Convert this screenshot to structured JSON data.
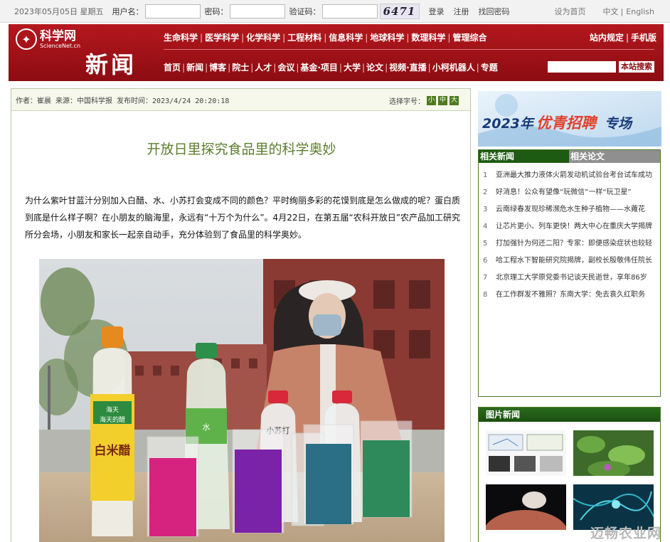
{
  "topbar": {
    "date": "2023年05月05日 星期五",
    "username_label": "用户名：",
    "password_label": "密码：",
    "captcha_label": "验证码：",
    "captcha_text": "6471",
    "login": "登录",
    "register": "注册",
    "forgot": "找回密码",
    "set_home": "设为首页",
    "lang_cn": "中文",
    "lang_sep": "|",
    "lang_en": "English"
  },
  "header": {
    "logo_cn": "科学网",
    "logo_en": "ScienceNet.cn",
    "section": "新闻",
    "nav1": [
      "生命科学",
      "医学科学",
      "化学科学",
      "工程材料",
      "信息科学",
      "地球科学",
      "数理科学",
      "管理综合"
    ],
    "nav_right": [
      "站内规定",
      "手机版"
    ],
    "nav2": [
      "首页",
      "新闻",
      "博客",
      "院士",
      "人才",
      "会议",
      "基金·项目",
      "大学",
      "论文",
      "视频·直播",
      "小柯机器人",
      "专题"
    ],
    "search_button": "本站搜索"
  },
  "article": {
    "meta": "作者：崔晨 来源：中国科学报 发布时间：2023/4/24 20:20:18",
    "font_select_label": "选择字号：",
    "font_sizes": [
      "小",
      "中",
      "大"
    ],
    "title": "开放日里探究食品里的科学奥妙",
    "body": "为什么紫叶甘蓝汁分别加入白醋、水、小苏打会变成不同的颜色？平时绚丽多彩的花馍到底是怎么做成的呢？蛋白质到底是什么样子啊？在小朋友的脑海里，永远有“十万个为什么”。4月22日，在第五届“农科开放日”农产品加工研究所分会场，小朋友和家长一起亲自动手，充分体验到了食品里的科学奥妙。",
    "photo": {
      "bottle1_brand": "海天",
      "bottle1_brand2": "海天的醋",
      "bottle1_label": "白米醋",
      "bottle2_label": "水",
      "bottle3_label": "小苏打",
      "colors": {
        "magenta": "#d6237f",
        "purple": "#7a22a8",
        "clear": "#e9eef0",
        "teal": "#2a6f86",
        "green": "#2e8a5a"
      }
    }
  },
  "sidebar": {
    "banner_year": "2023年",
    "banner_highlight": "优青招聘",
    "banner_tail": "专场",
    "tab_news": "相关新闻",
    "tab_papers": "相关论文",
    "related": [
      {
        "num": "1",
        "text": "亚洲最大推力液体火箭发动机试验台考台试车成功"
      },
      {
        "num": "2",
        "text": "好消息！公众有望像“玩微信”一样“玩卫星”"
      },
      {
        "num": "3",
        "text": "云南绿春发现珍稀濒危水生种子植物——水蕹花"
      },
      {
        "num": "4",
        "text": "让芯片更小、列车更快！两大中心在重庆大学揭牌"
      },
      {
        "num": "5",
        "text": "打加强针为何还二阳？专家：即便感染症状也较轻"
      },
      {
        "num": "6",
        "text": "哈工程水下智能研究院揭牌，副校长殷敬伟任院长"
      },
      {
        "num": "7",
        "text": "北京理工大学原党委书记谈天民逝世，享年86岁"
      },
      {
        "num": "8",
        "text": "在工作群发不雅照？东南大学：免去袁久红职务"
      }
    ],
    "photo_news_title": "图片新闻"
  },
  "watermark": "迈畅农业网"
}
